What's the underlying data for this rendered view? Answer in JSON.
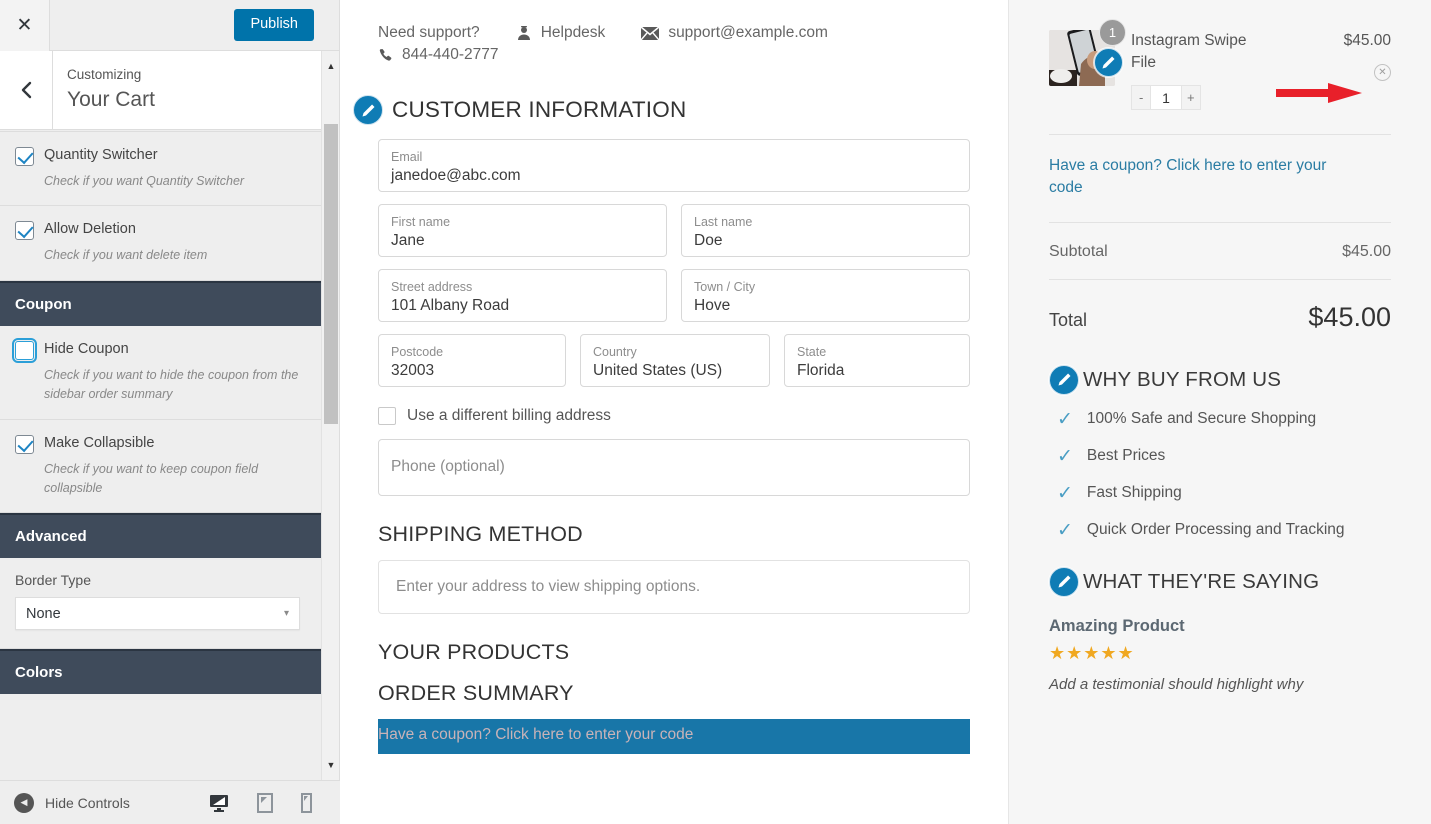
{
  "customizer": {
    "close_label": "✕",
    "publish_label": "Publish",
    "back_icon": "chevron-left-icon",
    "subtitle": "Customizing",
    "title": "Your Cart",
    "controls": [
      {
        "id": "quantity-switcher",
        "label": "Quantity Switcher",
        "description": "Check if you want Quantity Switcher",
        "checked": true,
        "focused": false
      },
      {
        "id": "allow-deletion",
        "label": "Allow Deletion",
        "description": "Check if you want delete item",
        "checked": true,
        "focused": false
      }
    ],
    "coupon_section": {
      "title": "Coupon",
      "controls": [
        {
          "id": "hide-coupon",
          "label": "Hide Coupon",
          "description": "Check if you want to hide the coupon from the sidebar order summary",
          "checked": false,
          "focused": true
        },
        {
          "id": "make-collapsible",
          "label": "Make Collapsible",
          "description": "Check if you want to keep coupon field collapsible",
          "checked": true,
          "focused": false
        }
      ]
    },
    "advanced_section": {
      "title": "Advanced",
      "border_type_label": "Border Type",
      "border_type_value": "None",
      "caret": "▾"
    },
    "colors_section": {
      "title": "Colors"
    },
    "bottom": {
      "hide_controls_label": "Hide Controls",
      "devices": [
        "desktop-icon",
        "tablet-icon",
        "mobile-icon"
      ],
      "active_device": "desktop-icon"
    },
    "accent_color": "#0073aa",
    "section_color": "#3f4b5b"
  },
  "preview": {
    "support": {
      "need_support_label": "Need support?",
      "helpdesk_label": "Helpdesk",
      "email": "support@example.com",
      "phone": "844-440-2777",
      "helpdesk_icon": "headset-icon",
      "email_icon": "envelope-icon",
      "phone_icon": "phone-icon"
    },
    "customer_information": {
      "heading": "CUSTOMER INFORMATION",
      "edit_icon": "edit-pencil-icon",
      "fields": [
        {
          "label": "Email",
          "value": "janedoe@abc.com"
        },
        {
          "label": "First name",
          "value": "Jane"
        },
        {
          "label": "Last name",
          "value": "Doe"
        },
        {
          "label": "Street address",
          "value": "101 Albany Road"
        },
        {
          "label": "Town / City",
          "value": "Hove"
        },
        {
          "label": "Postcode",
          "value": "32003"
        },
        {
          "label": "Country",
          "value": "United States (US)"
        },
        {
          "label": "State",
          "value": "Florida"
        }
      ],
      "billing_checkbox_label": "Use a different billing address",
      "billing_checked": false,
      "phone_placeholder": "Phone (optional)"
    },
    "shipping": {
      "heading": "SHIPPING METHOD",
      "message": "Enter your address to view shipping options."
    },
    "your_products_heading": "YOUR PRODUCTS",
    "order_summary_heading": "ORDER SUMMARY",
    "coupon_bar_label": "Have a coupon? Click here to enter your code",
    "coupon_bar_bg": "#1876a8"
  },
  "cart": {
    "item": {
      "name": "Instagram Swipe File",
      "price": "$45.00",
      "quantity": "1",
      "qty_badge": "1",
      "decrement": "-",
      "increment": "+",
      "remove_label": "✕",
      "thumb_icon": "product-thumbnail"
    },
    "coupon_link": "Have a coupon? Click here to enter your code",
    "subtotal_label": "Subtotal",
    "subtotal_value": "$45.00",
    "total_label": "Total",
    "total_value": "$45.00",
    "why_buy": {
      "heading": "WHY BUY FROM US",
      "edit_icon": "edit-pencil-icon",
      "items": [
        "100% Safe and Secure Shopping",
        "Best Prices",
        "Fast Shipping",
        "Quick Order Processing and Tracking"
      ]
    },
    "testimonials": {
      "heading": "WHAT THEY'RE SAYING",
      "edit_icon": "edit-pencil-icon",
      "title": "Amazing Product",
      "stars": "★★★★★",
      "text": "Add a testimonial should highlight why"
    }
  },
  "annotation": {
    "arrow": "red-arrow-pointing-right",
    "color": "#e8202a"
  }
}
